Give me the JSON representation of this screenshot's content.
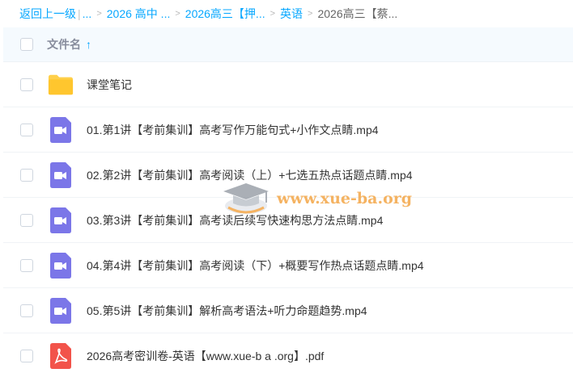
{
  "breadcrumb": {
    "back": "返回上一级",
    "ellipsis": "...",
    "crumbs": [
      "2026 高中 ...",
      "2026高三【押...",
      "英语"
    ],
    "current": "2026高三【蔡..."
  },
  "header": {
    "name_col": "文件名",
    "sort_icon": "arrow-up-icon"
  },
  "files": [
    {
      "name": "课堂笔记",
      "type": "folder"
    },
    {
      "name": "01.第1讲【考前集训】高考写作万能句式+小作文点睛.mp4",
      "type": "video"
    },
    {
      "name": "02.第2讲【考前集训】高考阅读（上）+七选五热点话题点睛.mp4",
      "type": "video"
    },
    {
      "name": "03.第3讲【考前集训】高考读后续写快速构思方法点睛.mp4",
      "type": "video"
    },
    {
      "name": "04.第4讲【考前集训】高考阅读（下）+概要写作热点话题点睛.mp4",
      "type": "video"
    },
    {
      "name": "05.第5讲【考前集训】解析高考语法+听力命题趋势.mp4",
      "type": "video"
    },
    {
      "name": "2026高考密训卷-英语【www.xue-b a .org】.pdf",
      "type": "pdf"
    }
  ],
  "watermark": {
    "text": "www.xue-ba.org",
    "icon": "graduation-cap-logo-icon"
  },
  "colors": {
    "accent": "#06a7ff",
    "folder": "#ffd04b",
    "video": "#7b76e8",
    "pdf": "#f2534a"
  }
}
